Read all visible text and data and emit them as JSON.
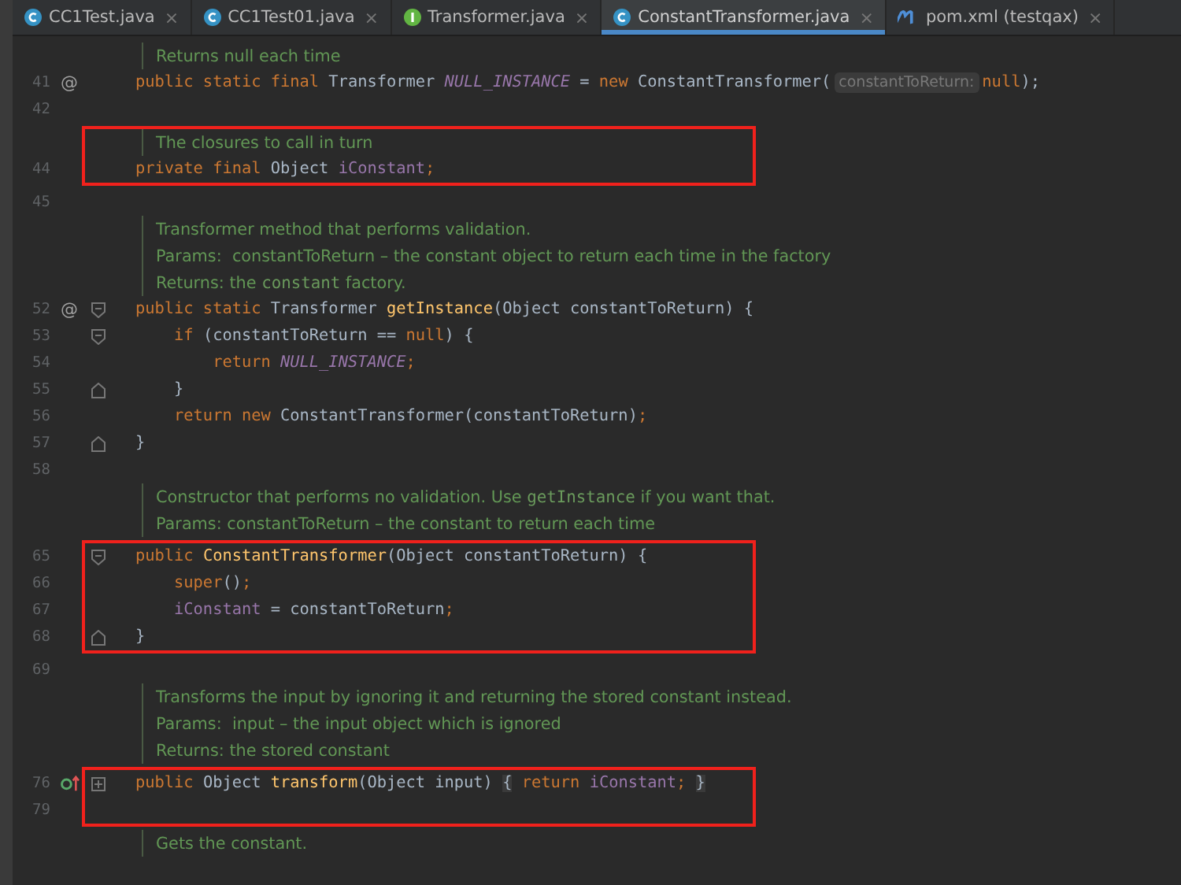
{
  "tabs": [
    {
      "label": "CC1Test.java",
      "kind": "class",
      "selected": false,
      "close": "×"
    },
    {
      "label": "CC1Test01.java",
      "kind": "class",
      "selected": false,
      "close": "×"
    },
    {
      "label": "Transformer.java",
      "kind": "interface",
      "selected": false,
      "close": "×"
    },
    {
      "label": "ConstantTransformer.java",
      "kind": "class",
      "selected": true,
      "close": "×"
    },
    {
      "label": "pom.xml (testqax)",
      "kind": "maven",
      "selected": false,
      "close": "×"
    }
  ],
  "blocks": [
    {
      "highlighted": false,
      "lines": [
        {
          "kind": "doc",
          "segments": [
            {
              "text": "Returns null each time",
              "kind": "text"
            }
          ]
        },
        {
          "kind": "code",
          "number": "41",
          "mark": "@",
          "segments": [
            {
              "text": "public static final ",
              "kind": "kw"
            },
            {
              "text": "Transformer ",
              "kind": "plain"
            },
            {
              "text": "NULL_INSTANCE",
              "kind": "static"
            },
            {
              "text": " = ",
              "kind": "plain"
            },
            {
              "text": "new ",
              "kind": "kw"
            },
            {
              "text": "ConstantTransformer(",
              "kind": "plain"
            },
            {
              "text": "constantToReturn:",
              "kind": "hint"
            },
            {
              "text": "null",
              "kind": "kw"
            },
            {
              "text": ");",
              "kind": "plain"
            }
          ]
        },
        {
          "kind": "code",
          "number": "42"
        }
      ]
    },
    {
      "highlighted": true,
      "lines": [
        {
          "kind": "doc",
          "segments": [
            {
              "text": "The closures to call in turn",
              "kind": "text"
            }
          ]
        },
        {
          "kind": "code",
          "number": "44",
          "segments": [
            {
              "text": "private final ",
              "kind": "kw"
            },
            {
              "text": "Object ",
              "kind": "plain"
            },
            {
              "text": "iConstant",
              "kind": "field"
            },
            {
              "text": ";",
              "kind": "kw"
            }
          ]
        }
      ]
    },
    {
      "highlighted": false,
      "lines": [
        {
          "kind": "code",
          "number": "45"
        },
        {
          "kind": "doc",
          "segments": [
            {
              "text": "Transformer method that performs validation.",
              "kind": "text"
            }
          ]
        },
        {
          "kind": "doc",
          "segments": [
            {
              "text": "Params:  constantToReturn – the constant object to return each time in the factory",
              "kind": "text"
            }
          ]
        },
        {
          "kind": "doc",
          "segments": [
            {
              "text": "Returns: the ",
              "kind": "text"
            },
            {
              "text": "constant",
              "kind": "code"
            },
            {
              "text": " factory.",
              "kind": "text"
            }
          ]
        },
        {
          "kind": "code",
          "number": "52",
          "mark": "@",
          "fold_marker": {
            "kind": "start"
          },
          "segments": [
            {
              "text": "public static ",
              "kind": "kw"
            },
            {
              "text": "Transformer ",
              "kind": "plain"
            },
            {
              "text": "getInstance",
              "kind": "method"
            },
            {
              "text": "(Object constantToReturn) {",
              "kind": "plain"
            }
          ]
        },
        {
          "kind": "code",
          "number": "53",
          "fold_marker": {
            "kind": "start"
          },
          "segments": [
            {
              "text": "    if ",
              "kind": "kw"
            },
            {
              "text": "(constantToReturn == ",
              "kind": "plain"
            },
            {
              "text": "null",
              "kind": "kw"
            },
            {
              "text": ") {",
              "kind": "plain"
            }
          ]
        },
        {
          "kind": "code",
          "number": "54",
          "segments": [
            {
              "text": "        return ",
              "kind": "kw"
            },
            {
              "text": "NULL_INSTANCE",
              "kind": "static"
            },
            {
              "text": ";",
              "kind": "kw"
            }
          ]
        },
        {
          "kind": "code",
          "number": "55",
          "fold_marker": {
            "kind": "end"
          },
          "segments": [
            {
              "text": "    }",
              "kind": "plain"
            }
          ]
        },
        {
          "kind": "code",
          "number": "56",
          "segments": [
            {
              "text": "    return new ",
              "kind": "kw"
            },
            {
              "text": "ConstantTransformer(constantToReturn)",
              "kind": "plain"
            },
            {
              "text": ";",
              "kind": "kw"
            }
          ]
        },
        {
          "kind": "code",
          "number": "57",
          "fold_marker": {
            "kind": "end"
          },
          "segments": [
            {
              "text": "}",
              "kind": "plain"
            }
          ]
        },
        {
          "kind": "code",
          "number": "58"
        },
        {
          "kind": "doc",
          "segments": [
            {
              "text": "Constructor that performs no validation. Use ",
              "kind": "text"
            },
            {
              "text": "getInstance",
              "kind": "code"
            },
            {
              "text": " if you want that.",
              "kind": "text"
            }
          ]
        },
        {
          "kind": "doc",
          "segments": [
            {
              "text": "Params: constantToReturn – the constant to return each time",
              "kind": "text"
            }
          ]
        }
      ]
    },
    {
      "highlighted": true,
      "lines": [
        {
          "kind": "code",
          "number": "65",
          "fold_marker": {
            "kind": "start"
          },
          "segments": [
            {
              "text": "public ",
              "kind": "kw"
            },
            {
              "text": "ConstantTransformer",
              "kind": "method"
            },
            {
              "text": "(Object constantToReturn) {",
              "kind": "plain"
            }
          ]
        },
        {
          "kind": "code",
          "number": "66",
          "segments": [
            {
              "text": "    super",
              "kind": "kw"
            },
            {
              "text": "()",
              "kind": "plain"
            },
            {
              "text": ";",
              "kind": "kw"
            }
          ]
        },
        {
          "kind": "code",
          "number": "67",
          "segments": [
            {
              "text": "    iConstant",
              "kind": "field"
            },
            {
              "text": " = constantToReturn",
              "kind": "plain"
            },
            {
              "text": ";",
              "kind": "kw"
            }
          ]
        },
        {
          "kind": "code",
          "number": "68",
          "fold_marker": {
            "kind": "end"
          },
          "segments": [
            {
              "text": "}",
              "kind": "plain"
            }
          ]
        }
      ]
    },
    {
      "highlighted": false,
      "lines": [
        {
          "kind": "code",
          "number": "69"
        },
        {
          "kind": "doc",
          "segments": [
            {
              "text": "Transforms the input by ignoring it and returning the stored constant instead.",
              "kind": "text"
            }
          ]
        },
        {
          "kind": "doc",
          "segments": [
            {
              "text": "Params:  input – the input object which is ignored",
              "kind": "text"
            }
          ]
        },
        {
          "kind": "doc",
          "segments": [
            {
              "text": "Returns: the stored constant",
              "kind": "text"
            }
          ]
        }
      ]
    },
    {
      "highlighted": true,
      "lines": [
        {
          "kind": "code",
          "number": "76",
          "override": true,
          "fold_marker": {
            "kind": "collapsed"
          },
          "segments": [
            {
              "text": "public ",
              "kind": "kw"
            },
            {
              "text": "Object ",
              "kind": "plain"
            },
            {
              "text": "transform",
              "kind": "method"
            },
            {
              "text": "(Object input) ",
              "kind": "plain"
            },
            {
              "text": "{",
              "kind": "folded"
            },
            {
              "text": " return ",
              "kind": "kw"
            },
            {
              "text": "iConstant",
              "kind": "field"
            },
            {
              "text": "; ",
              "kind": "kw"
            },
            {
              "text": "}",
              "kind": "folded"
            }
          ]
        },
        {
          "kind": "code",
          "number": "79"
        }
      ]
    },
    {
      "highlighted": false,
      "lines": [
        {
          "kind": "doc",
          "segments": [
            {
              "text": "Gets the constant.",
              "kind": "text"
            }
          ]
        }
      ]
    }
  ]
}
